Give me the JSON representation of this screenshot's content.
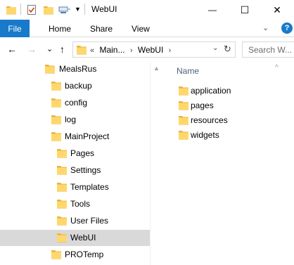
{
  "window": {
    "title": "WebUI",
    "buttons": {
      "minimize": "—",
      "maximize": "☐",
      "close": "✕"
    }
  },
  "ribbon": {
    "tabs": {
      "file": "File",
      "home": "Home",
      "share": "Share",
      "view": "View"
    },
    "expand_glyph": "⌄",
    "help_glyph": "?"
  },
  "navigation": {
    "back": "←",
    "forward": "→",
    "recent": "⌄",
    "up": "↑",
    "address": {
      "overflow": "«",
      "parent": "Main...",
      "current": "WebUI",
      "separator": "›",
      "dropdown": "⌄",
      "refresh": "↻"
    },
    "search_placeholder": "Search W..."
  },
  "tree": [
    {
      "label": "MealsRus",
      "selected": false
    },
    {
      "label": "backup",
      "selected": false
    },
    {
      "label": "config",
      "selected": false
    },
    {
      "label": "log",
      "selected": false
    },
    {
      "label": "MainProject",
      "selected": false
    },
    {
      "label": "Pages",
      "selected": false
    },
    {
      "label": "Settings",
      "selected": false
    },
    {
      "label": "Templates",
      "selected": false
    },
    {
      "label": "Tools",
      "selected": false
    },
    {
      "label": "User Files",
      "selected": false
    },
    {
      "label": "WebUI",
      "selected": true
    },
    {
      "label": "PROTemp",
      "selected": false
    }
  ],
  "content": {
    "column_header": "Name",
    "sort_indicator": "^",
    "items": [
      "application",
      "pages",
      "resources",
      "widgets"
    ]
  },
  "colors": {
    "accent": "#1979ca",
    "folder_fill": "#ffd86c",
    "folder_tab": "#e8b53c",
    "selection": "#d9d9d9"
  },
  "icons": {
    "folder": "folder-icon",
    "properties": "properties-icon",
    "customize": "customize-toolbar-icon",
    "help": "help-icon"
  }
}
